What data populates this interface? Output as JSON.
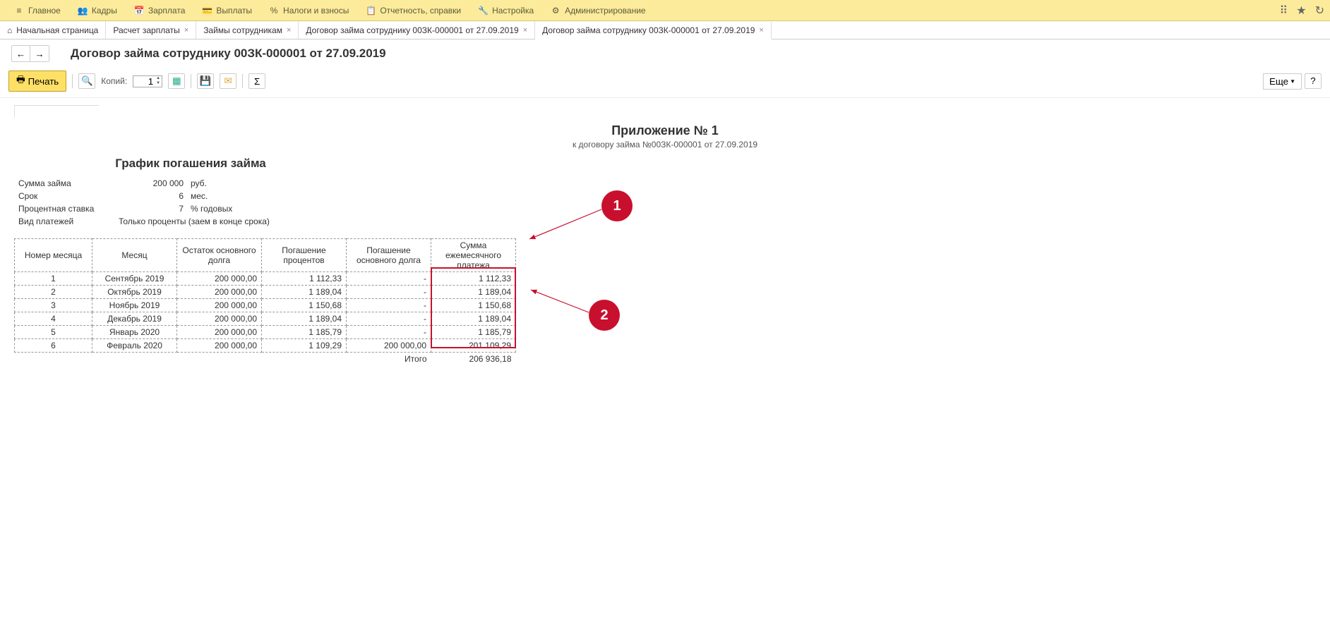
{
  "topmenu": {
    "items": [
      {
        "icon": "≡",
        "label": "Главное"
      },
      {
        "icon": "👥",
        "label": "Кадры"
      },
      {
        "icon": "📅",
        "label": "Зарплата"
      },
      {
        "icon": "💳",
        "label": "Выплаты"
      },
      {
        "icon": "%",
        "label": "Налоги и взносы"
      },
      {
        "icon": "📋",
        "label": "Отчетность, справки"
      },
      {
        "icon": "🔧",
        "label": "Настройка"
      },
      {
        "icon": "⚙",
        "label": "Администрирование"
      }
    ]
  },
  "tabs": [
    {
      "icon": "⌂",
      "label": "Начальная страница",
      "closable": false
    },
    {
      "label": "Расчет зарплаты",
      "closable": true
    },
    {
      "label": "Займы сотрудникам",
      "closable": true
    },
    {
      "label": "Договор займа сотруднику 00ЗК-000001 от 27.09.2019",
      "closable": true
    },
    {
      "label": "Договор займа сотруднику 00ЗК-000001 от 27.09.2019",
      "closable": true,
      "active": true
    }
  ],
  "page_title": "Договор займа сотруднику 00ЗК-000001 от 27.09.2019",
  "toolbar": {
    "print": "Печать",
    "copies_label": "Копий:",
    "copies_value": "1",
    "more": "Еще"
  },
  "doc": {
    "title1": "Приложение № 1",
    "sub": "к договору займа №00ЗК-000001 от 27.09.2019",
    "title2": "График погашения займа",
    "info": [
      {
        "label": "Сумма займа",
        "value": "200 000",
        "unit": "руб."
      },
      {
        "label": "Срок",
        "value": "6",
        "unit": "мес."
      },
      {
        "label": "Процентная ставка",
        "value": "7",
        "unit": "% годовых"
      },
      {
        "label": "Вид платежей",
        "value_text": "Только проценты (заем в конце срока)"
      }
    ],
    "headers": [
      "Номер месяца",
      "Месяц",
      "Остаток основного долга",
      "Погашение процентов",
      "Погашение основного долга",
      "Сумма ежемесячного платежа"
    ],
    "rows": [
      {
        "n": "1",
        "month": "Сентябрь 2019",
        "rest": "200 000,00",
        "perc": "1 112,33",
        "main": "-",
        "sum": "1 112,33"
      },
      {
        "n": "2",
        "month": "Октябрь 2019",
        "rest": "200 000,00",
        "perc": "1 189,04",
        "main": "-",
        "sum": "1 189,04"
      },
      {
        "n": "3",
        "month": "Ноябрь 2019",
        "rest": "200 000,00",
        "perc": "1 150,68",
        "main": "-",
        "sum": "1 150,68"
      },
      {
        "n": "4",
        "month": "Декабрь 2019",
        "rest": "200 000,00",
        "perc": "1 189,04",
        "main": "-",
        "sum": "1 189,04"
      },
      {
        "n": "5",
        "month": "Январь 2020",
        "rest": "200 000,00",
        "perc": "1 185,79",
        "main": "-",
        "sum": "1 185,79"
      },
      {
        "n": "6",
        "month": "Февраль 2020",
        "rest": "200 000,00",
        "perc": "1 109,29",
        "main": "200 000,00",
        "sum": "201 109,29"
      }
    ],
    "total_label": "Итого",
    "total_value": "206 936,18"
  },
  "callouts": {
    "a": "1",
    "b": "2"
  }
}
